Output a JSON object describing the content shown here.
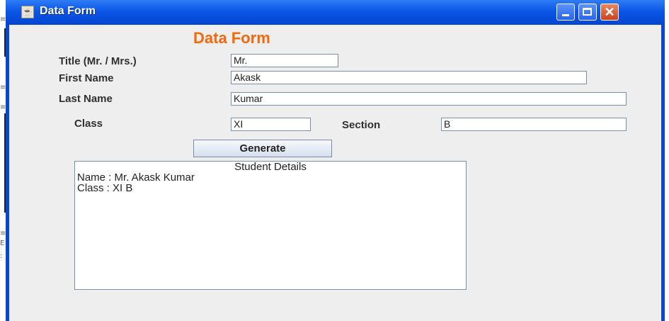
{
  "window": {
    "title": "Data Form",
    "controls": {
      "minimize": "minimize-icon",
      "maximize": "maximize-icon",
      "close": "close-icon"
    }
  },
  "form": {
    "heading": "Data Form",
    "title_label": "Title (Mr. / Mrs.)",
    "title_value": "Mr.",
    "first_name_label": "First Name",
    "first_name_value": "Akask",
    "last_name_label": "Last Name",
    "last_name_value": "Kumar",
    "class_label": "Class",
    "class_value": "XI",
    "section_label": "Section",
    "section_value": "B",
    "generate_label": "Generate"
  },
  "output": {
    "lines": [
      "Student Details",
      "Name : Mr. Akask Kumar",
      "Class : XI B"
    ]
  },
  "colors": {
    "title_bar": "#0b56e6",
    "heading": "#f5690a",
    "close_button": "#c9421f"
  }
}
